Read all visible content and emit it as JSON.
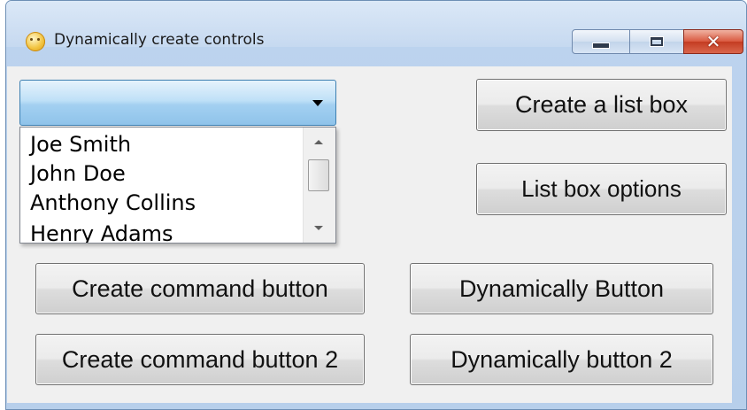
{
  "window": {
    "title": "Dynamically create controls",
    "icon": "app-smiley-icon",
    "controls": {
      "minimize": "minimize-icon",
      "maximize": "maximize-icon",
      "close_glyph": "✕"
    }
  },
  "combo": {
    "selected_value": "",
    "arrow_icon": "chevron-down-icon"
  },
  "listbox": {
    "items": [
      "Joe Smith",
      "John Doe",
      "Anthony Collins",
      "Henry Adams"
    ]
  },
  "buttons": {
    "create_list_box": "Create a list box",
    "list_box_options": "List box options",
    "create_command_button": "Create command button",
    "dynamically_button": "Dynamically Button",
    "create_command_button_2": "Create command button 2",
    "dynamically_button_2": "Dynamically button 2"
  },
  "colors": {
    "close_button": "#c43c22",
    "combo_accent": "#8fc3ea",
    "client_background": "#f0f0f0"
  }
}
